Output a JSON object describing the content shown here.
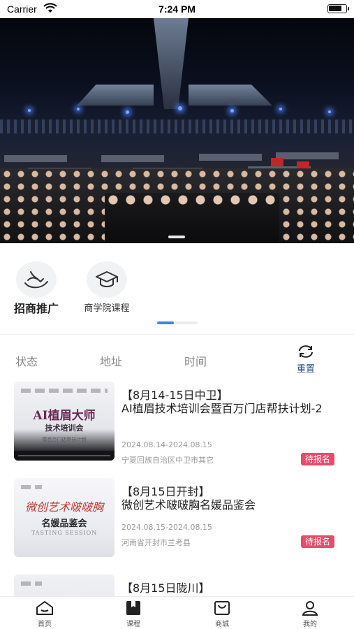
{
  "status_bar": {
    "carrier": "Carrier",
    "time": "7:24 PM"
  },
  "categories": [
    {
      "label": "招商推广",
      "icon": "handshake-icon",
      "active": true
    },
    {
      "label": "商学院课程",
      "icon": "graduation-cap-icon",
      "active": false
    }
  ],
  "filters": {
    "status": "状态",
    "address": "地址",
    "time": "时间",
    "reset": "重置"
  },
  "courses": [
    {
      "tag": "【8月14-15日中卫】",
      "title": "AI植眉技术培训会暨百万门店帮扶计划-2",
      "date": "2024.08.14-2024.08.15",
      "address": "宁夏回族自治区中卫市其它",
      "status": "待报名",
      "thumb": {
        "line1": "AI植眉大师",
        "line2": "技术培训会",
        "line3": "暨百万门店帮扶计划"
      }
    },
    {
      "tag": "【8月15日开封】",
      "title": "微创艺术啵啵胸名媛品鉴会",
      "date": "2024.08.15-2024.08.15",
      "address": "河南省开封市兰考县",
      "status": "待报名",
      "thumb": {
        "line1": "微创艺术啵啵胸",
        "line2": "名媛品鉴会",
        "line3": "TASTING SESSION"
      }
    },
    {
      "tag": "【8月15日陇川】"
    }
  ],
  "tabbar": [
    {
      "label": "首页",
      "icon": "home-icon"
    },
    {
      "label": "课程",
      "icon": "course-book-icon"
    },
    {
      "label": "商城",
      "icon": "shopping-bag-icon"
    },
    {
      "label": "我的",
      "icon": "profile-icon"
    }
  ],
  "colors": {
    "accent": "#3a86e8",
    "badge": "#e94b6b",
    "reset": "#2d4c87"
  }
}
